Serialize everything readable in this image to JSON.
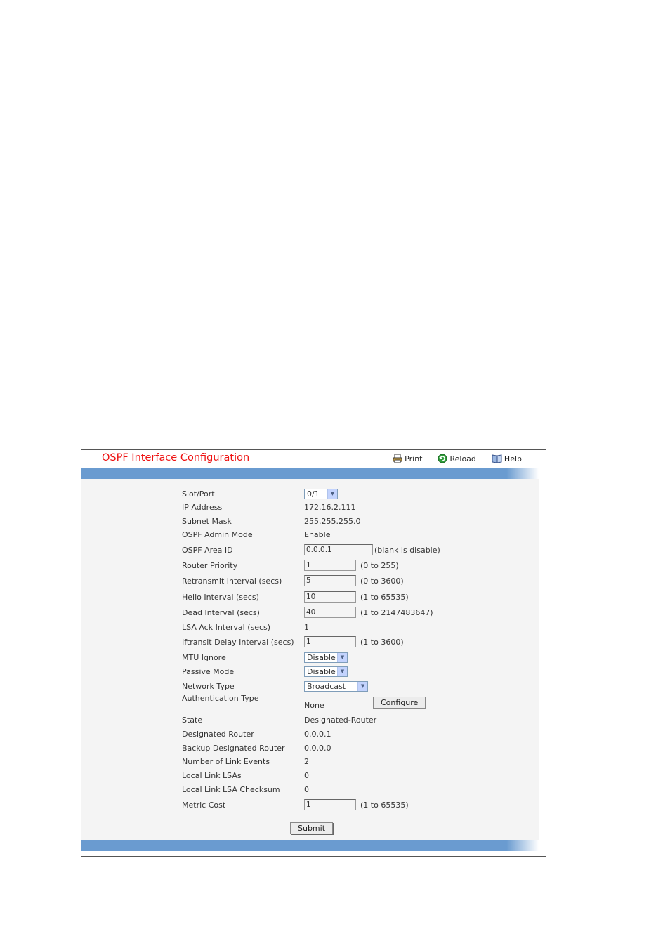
{
  "page": {
    "title": "OSPF Interface Configuration",
    "toolbar": {
      "print": "Print",
      "reload": "Reload",
      "help": "Help"
    }
  },
  "form": {
    "slot_port": {
      "label": "Slot/Port",
      "value": "0/1"
    },
    "ip_address": {
      "label": "IP Address",
      "value": "172.16.2.111"
    },
    "subnet_mask": {
      "label": "Subnet Mask",
      "value": "255.255.255.0"
    },
    "admin_mode": {
      "label": "OSPF Admin Mode",
      "value": "Enable"
    },
    "area_id": {
      "label": "OSPF Area ID",
      "value": "0.0.0.1",
      "range": "(blank is disable)"
    },
    "router_priority": {
      "label": "Router Priority",
      "value": "1",
      "range": "(0 to 255)"
    },
    "retransmit": {
      "label": "Retransmit Interval (secs)",
      "value": "5",
      "range": "(0 to 3600)"
    },
    "hello": {
      "label": "Hello Interval (secs)",
      "value": "10",
      "range": "(1 to 65535)"
    },
    "dead": {
      "label": "Dead Interval (secs)",
      "value": "40",
      "range": "(1 to 2147483647)"
    },
    "lsa_ack": {
      "label": "LSA Ack Interval (secs)",
      "value": "1"
    },
    "iftransit": {
      "label": "Iftransit Delay Interval (secs)",
      "value": "1",
      "range": "(1 to 3600)"
    },
    "mtu_ignore": {
      "label": "MTU Ignore",
      "value": "Disable"
    },
    "passive_mode": {
      "label": "Passive Mode",
      "value": "Disable"
    },
    "network_type": {
      "label": "Network Type",
      "value": "Broadcast"
    },
    "auth_type": {
      "label": "Authentication Type",
      "value": "None",
      "button": "Configure"
    },
    "state": {
      "label": "State",
      "value": "Designated-Router"
    },
    "dr": {
      "label": "Designated Router",
      "value": "0.0.0.1"
    },
    "bdr": {
      "label": "Backup Designated Router",
      "value": "0.0.0.0"
    },
    "link_events": {
      "label": "Number of Link Events",
      "value": "2"
    },
    "local_lsas": {
      "label": "Local Link LSAs",
      "value": "0"
    },
    "lsa_checksum": {
      "label": "Local Link LSA Checksum",
      "value": "0"
    },
    "metric_cost": {
      "label": "Metric Cost",
      "value": "1",
      "range": "(1 to 65535)"
    },
    "submit": "Submit"
  },
  "colors": {
    "title": "#ee1111",
    "bar": "#6a9bd0",
    "panel": "#f4f4f4"
  }
}
